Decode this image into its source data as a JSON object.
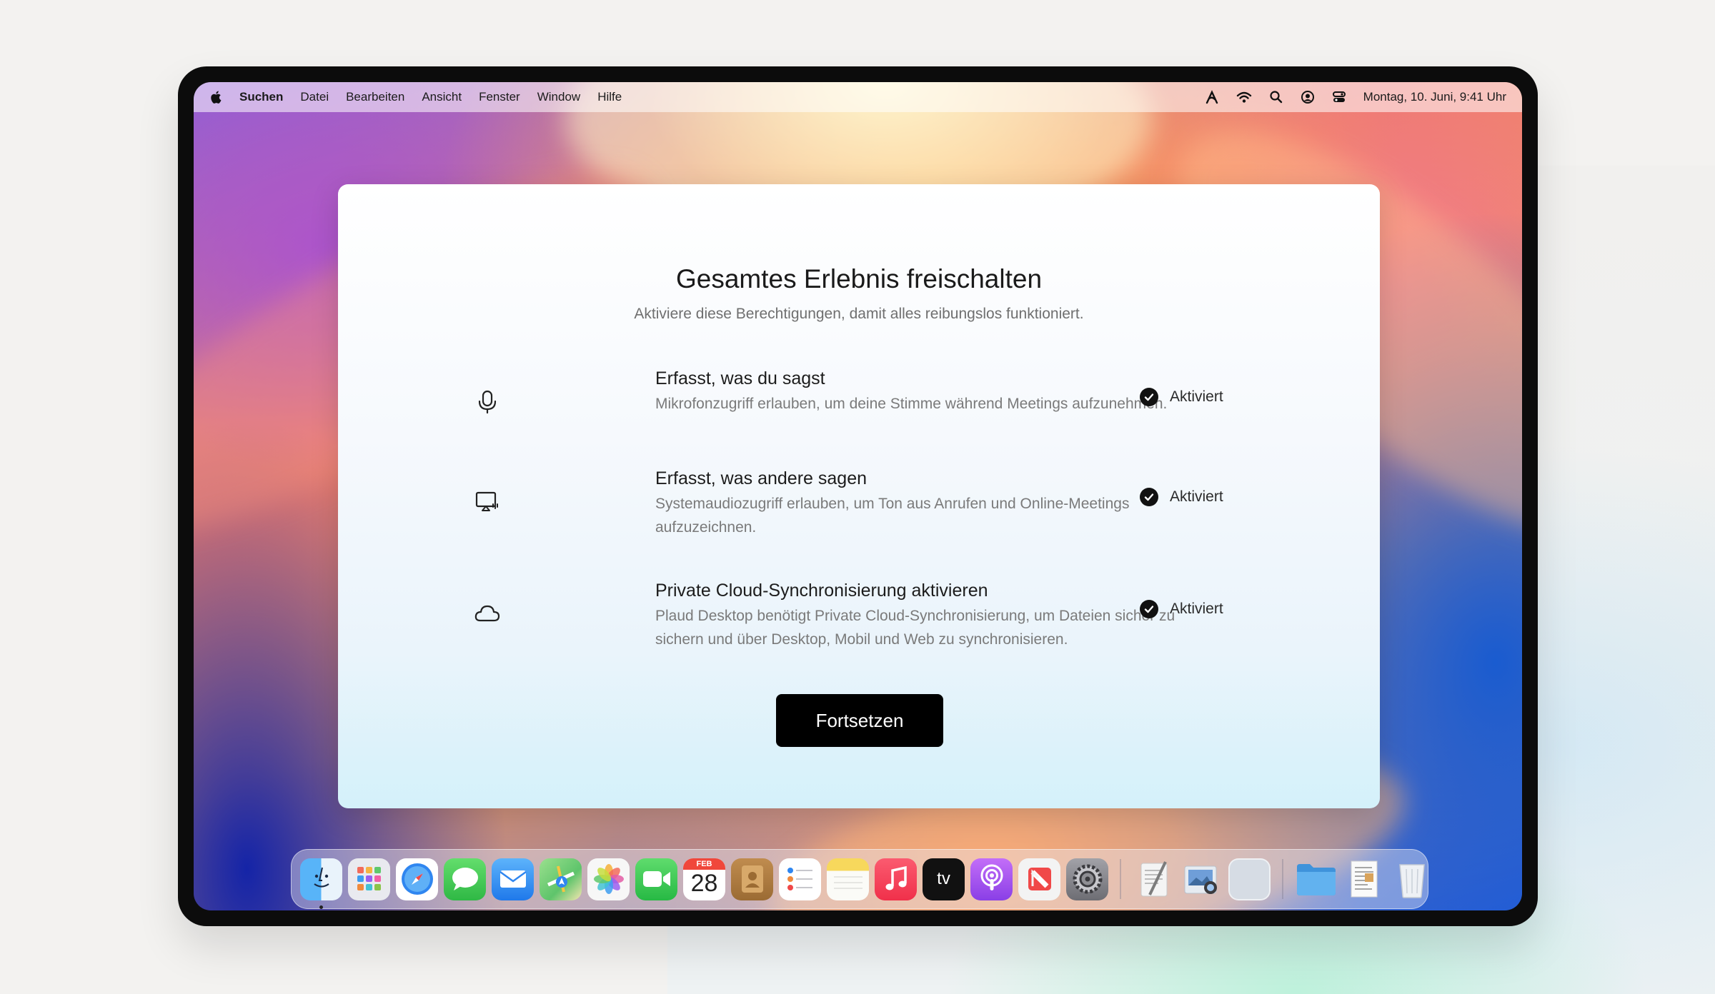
{
  "menubar": {
    "app_name": "Suchen",
    "items": [
      "Datei",
      "Bearbeiten",
      "Ansicht",
      "Fenster",
      "Window",
      "Hilfe"
    ],
    "status_icons": [
      "text-input-icon",
      "wifi-icon",
      "search-icon",
      "user-icon",
      "control-center-icon"
    ],
    "clock": "Montag, 10. Juni, 9:41 Uhr"
  },
  "dialog": {
    "title": "Gesamtes Erlebnis freischalten",
    "subtitle": "Aktiviere diese Berechtigungen, damit alles reibungslos funktioniert.",
    "permissions": [
      {
        "icon": "microphone-icon",
        "title": "Erfasst, was du sagst",
        "description": "Mikrofonzugriff erlauben, um deine Stimme während Meetings aufzunehmen.",
        "status": "Aktiviert"
      },
      {
        "icon": "screen-audio-icon",
        "title": "Erfasst, was andere sagen",
        "description": "Systemaudiozugriff erlauben, um Ton aus Anrufen und Online-Meetings aufzuzeichnen.",
        "status": "Aktiviert"
      },
      {
        "icon": "cloud-icon",
        "title": "Private Cloud-Synchronisierung aktivieren",
        "description": "Plaud Desktop benötigt Private Cloud-Synchronisierung, um Dateien sicher zu sichern und über Desktop, Mobil und Web zu synchronisieren.",
        "status": "Aktiviert"
      }
    ],
    "continue_label": "Fortsetzen"
  },
  "dock": {
    "apps": [
      {
        "name": "finder-icon",
        "color": "#3a9bf0"
      },
      {
        "name": "launchpad-icon",
        "color": "#e9eaef"
      },
      {
        "name": "safari-icon",
        "color": "#2f7ff0"
      },
      {
        "name": "messages-icon",
        "color": "#35c759"
      },
      {
        "name": "mail-icon",
        "color": "#2d8cf0"
      },
      {
        "name": "maps-icon",
        "color": "#6cc36a"
      },
      {
        "name": "photos-icon",
        "color": "#f5f5f5"
      },
      {
        "name": "facetime-icon",
        "color": "#32c04f"
      },
      {
        "name": "calendar-icon",
        "color": "#ffffff"
      },
      {
        "name": "contacts-icon",
        "color": "#a5763f"
      },
      {
        "name": "reminders-icon",
        "color": "#ffffff"
      },
      {
        "name": "notes-icon",
        "color": "#f7d85c"
      },
      {
        "name": "music-icon",
        "color": "#f0384f"
      },
      {
        "name": "tv-icon",
        "color": "#111111"
      },
      {
        "name": "podcasts-icon",
        "color": "#9a4ef0"
      },
      {
        "name": "news-icon",
        "color": "#f3f3f3"
      },
      {
        "name": "system-settings-icon",
        "color": "#8e8e93"
      }
    ],
    "calendar_month": "FEB",
    "calendar_day": "28",
    "tv_label": "tv",
    "recent": [
      {
        "name": "textedit-icon",
        "color": "#f2f2f2"
      },
      {
        "name": "preview-icon",
        "color": "#dfe6ef"
      },
      {
        "name": "blank-app-icon",
        "color": "#d6dce4"
      }
    ],
    "stacks": [
      {
        "name": "folder-icon",
        "color": "#4fa4e8"
      },
      {
        "name": "document-icon",
        "color": "#f7f7f7"
      },
      {
        "name": "trash-icon",
        "color": "#e4e8ee"
      }
    ]
  }
}
